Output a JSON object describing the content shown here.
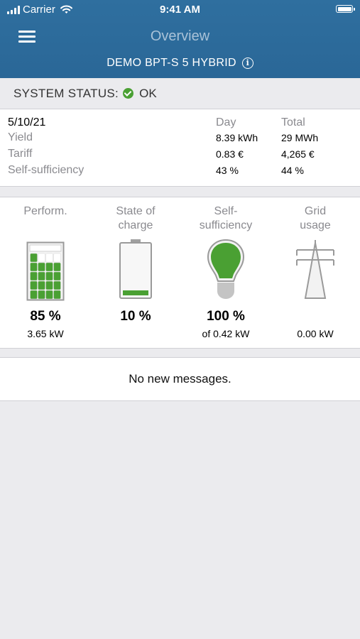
{
  "status_bar": {
    "carrier": "Carrier",
    "time": "9:41 AM"
  },
  "nav": {
    "title": "Overview",
    "device_name": "DEMO BPT-S 5 HYBRID",
    "info_glyph": "i"
  },
  "system_status": {
    "label": "SYSTEM STATUS:",
    "value": "OK",
    "ok_color": "#4aa033"
  },
  "stats": {
    "date": "5/10/21",
    "columns": [
      "Day",
      "Total"
    ],
    "rows": [
      {
        "label": "Yield",
        "day": "8.39 kWh",
        "total": "29 MWh"
      },
      {
        "label": "Tariff",
        "day": "0.83 €",
        "total": "4,265 €"
      },
      {
        "label": "Self-sufficiency",
        "day": "43 %",
        "total": "44 %"
      }
    ]
  },
  "tiles": [
    {
      "title_lines": [
        "Perform."
      ],
      "icon": "solar-panel-icon",
      "percent": "85 %",
      "sub": "3.65 kW",
      "level": 0.85
    },
    {
      "title_lines": [
        "State of",
        "charge"
      ],
      "icon": "battery-icon",
      "percent": "10 %",
      "sub": "",
      "level": 0.1
    },
    {
      "title_lines": [
        "Self-",
        "sufficiency"
      ],
      "icon": "lightbulb-icon",
      "percent": "100 %",
      "sub": "of 0.42 kW",
      "level": 1.0
    },
    {
      "title_lines": [
        "Grid",
        "usage"
      ],
      "icon": "power-pylon-icon",
      "percent": "",
      "sub": "0.00 kW"
    }
  ],
  "messages": {
    "text": "No new messages."
  },
  "colors": {
    "header": "#2a6797",
    "accent_green": "#4aa033",
    "background": "#ebebee"
  }
}
